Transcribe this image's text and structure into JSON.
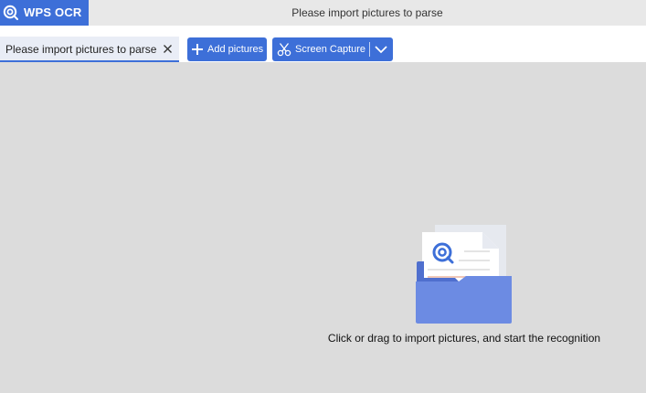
{
  "app": {
    "brand_name": "WPS OCR",
    "window_title": "Please import pictures to parse",
    "accent_color": "#3d6fd8"
  },
  "tabs": [
    {
      "label": "Please import pictures to parse",
      "active": true,
      "close_icon": "close-icon"
    }
  ],
  "toolbar": {
    "add_pictures_label": "Add pictures",
    "add_pictures_icon": "plus-icon",
    "screen_capture_label": "Screen Capture",
    "screen_capture_icon": "scissors-icon",
    "screen_capture_dropdown_icon": "chevron-down-icon"
  },
  "empty_state": {
    "illustration_icon": "folder-document-icon",
    "hint": "Click or drag to import pictures, and start the recognition"
  }
}
